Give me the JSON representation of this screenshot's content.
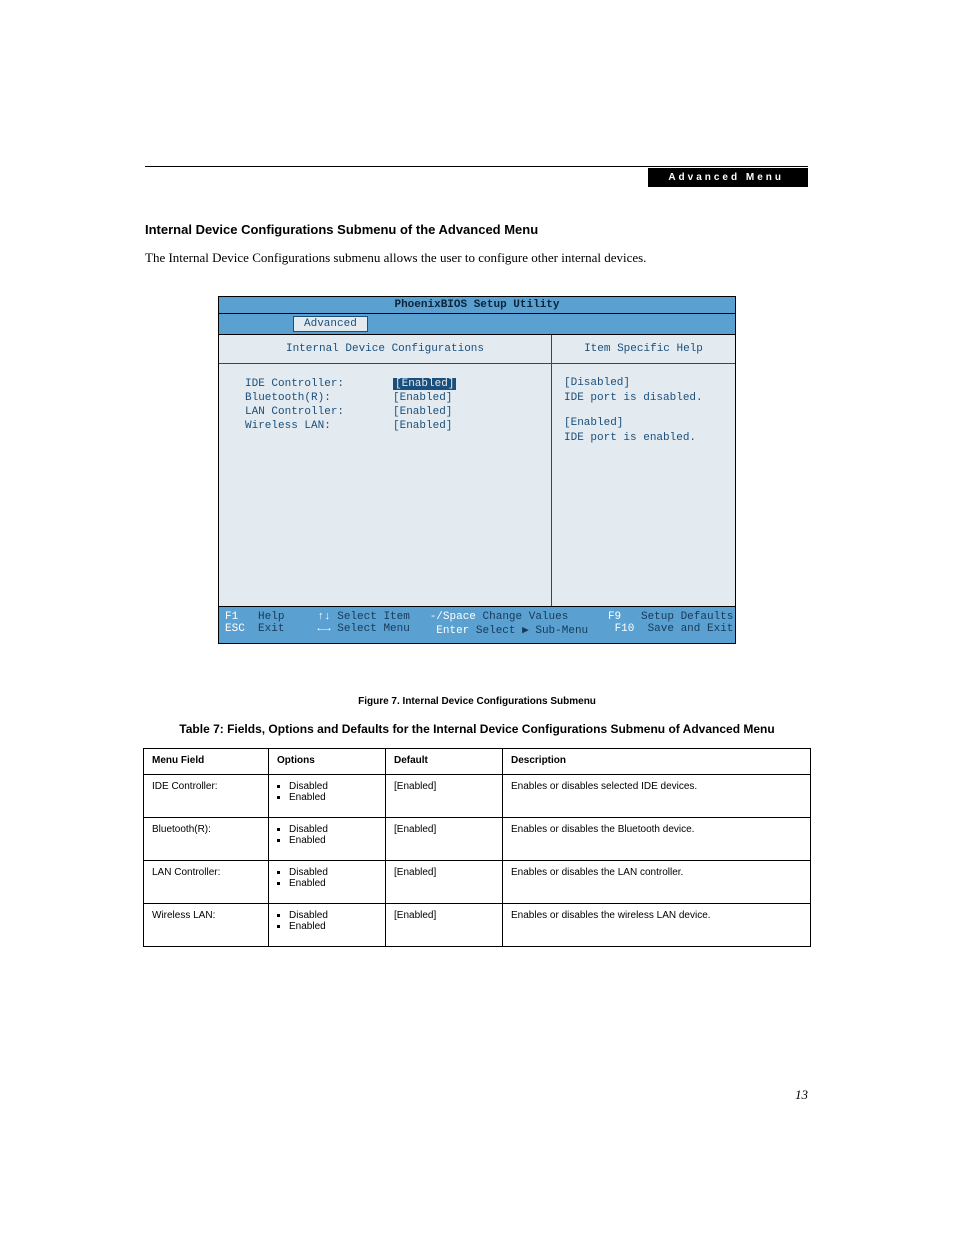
{
  "header": {
    "label": "Advanced Menu"
  },
  "section": {
    "title": "Internal Device Configurations Submenu of the Advanced Menu",
    "intro": "The Internal Device Configurations submenu allows the user to configure other internal devices."
  },
  "bios": {
    "title": "PhoenixBIOS Setup Utility",
    "active_tab": "Advanced",
    "left_panel_title": "Internal Device Configurations",
    "right_panel_title": "Item Specific Help",
    "items": [
      {
        "label": "IDE Controller:",
        "value": "[Enabled]",
        "selected": true
      },
      {
        "label": "Bluetooth(R):",
        "value": "[Enabled]",
        "selected": false
      },
      {
        "label": "LAN Controller:",
        "value": "[Enabled]",
        "selected": false
      },
      {
        "label": "Wireless LAN:",
        "value": "[Enabled]",
        "selected": false
      }
    ],
    "help": {
      "disabled_label": "[Disabled]",
      "disabled_text": "IDE port is disabled.",
      "enabled_label": "[Enabled]",
      "enabled_text": "IDE port is enabled."
    },
    "footer": {
      "f1": "F1",
      "help": "Help",
      "updown": "↑↓",
      "select_item": "Select Item",
      "minus_space": "-/Space",
      "change_values": "Change Values",
      "f9": "F9",
      "setup_defaults": "Setup Defaults",
      "esc": "ESC",
      "exit": "Exit",
      "leftright": "←→",
      "select_menu": "Select Menu",
      "enter": "Enter",
      "select_submenu": "Select ▶ Sub-Menu",
      "f10": "F10",
      "save_exit": "Save and Exit"
    }
  },
  "figure_caption": "Figure 7.  Internal Device Configurations Submenu",
  "table_title": "Table 7: Fields, Options and Defaults for the Internal Device Configurations Submenu of Advanced Menu",
  "table": {
    "headers": {
      "field": "Menu Field",
      "options": "Options",
      "default": "Default",
      "description": "Description"
    },
    "rows": [
      {
        "field": "IDE Controller:",
        "options": [
          "Disabled",
          "Enabled"
        ],
        "default": "[Enabled]",
        "description": "Enables or disables selected IDE devices."
      },
      {
        "field": "Bluetooth(R):",
        "options": [
          "Disabled",
          "Enabled"
        ],
        "default": "[Enabled]",
        "description": "Enables or disables the Bluetooth device."
      },
      {
        "field": "LAN Controller:",
        "options": [
          "Disabled",
          "Enabled"
        ],
        "default": "[Enabled]",
        "description": "Enables or disables the LAN controller."
      },
      {
        "field": "Wireless LAN:",
        "options": [
          "Disabled",
          "Enabled"
        ],
        "default": "[Enabled]",
        "description": "Enables or disables the wireless LAN device."
      }
    ]
  },
  "page_number": "13"
}
